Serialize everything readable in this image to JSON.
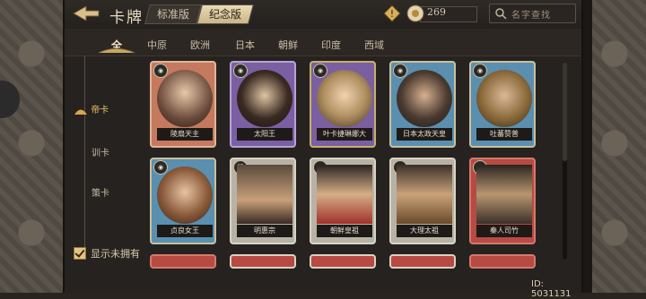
{
  "header": {
    "title": "卡牌",
    "version_tabs": [
      "标准版",
      "纪念版"
    ],
    "active_version": "纪念版",
    "currency_value": "269",
    "search_placeholder": "名字查找"
  },
  "categories": [
    "全",
    "中原",
    "欧洲",
    "日本",
    "朝鲜",
    "印度",
    "西域"
  ],
  "active_category": "全",
  "sidebar": {
    "items": [
      "帝卡",
      "训卡",
      "策卡"
    ],
    "active_item": "帝卡",
    "show_unowned_label": "显示未拥有",
    "show_unowned_checked": true
  },
  "cards": [
    {
      "name": "陵扇天主",
      "badge": "",
      "frame": "#c5795f"
    },
    {
      "name": "太阳王",
      "badge": "",
      "frame": "#7a5fa3"
    },
    {
      "name": "叶卡捷琳娜大",
      "badge": "",
      "frame": "#7a5fa3"
    },
    {
      "name": "日本太政天皇",
      "badge": "",
      "frame": "#5a8fb0"
    },
    {
      "name": "吐蕃赞普",
      "badge": "",
      "frame": "#5a8fb0"
    },
    {
      "name": "贞良女王",
      "badge": "",
      "frame": "#5a8fb0"
    },
    {
      "name": "明惠宗",
      "badge": "明",
      "frame": "#b8b2a6"
    },
    {
      "name": "朝鲜皇祖",
      "badge": "",
      "frame": "#b8b2a6"
    },
    {
      "name": "大理太祖",
      "badge": "",
      "frame": "#b8b2a6"
    },
    {
      "name": "秦人司竹",
      "badge": "",
      "frame": "#b74a42"
    }
  ],
  "player_id": "ID: 5031131"
}
